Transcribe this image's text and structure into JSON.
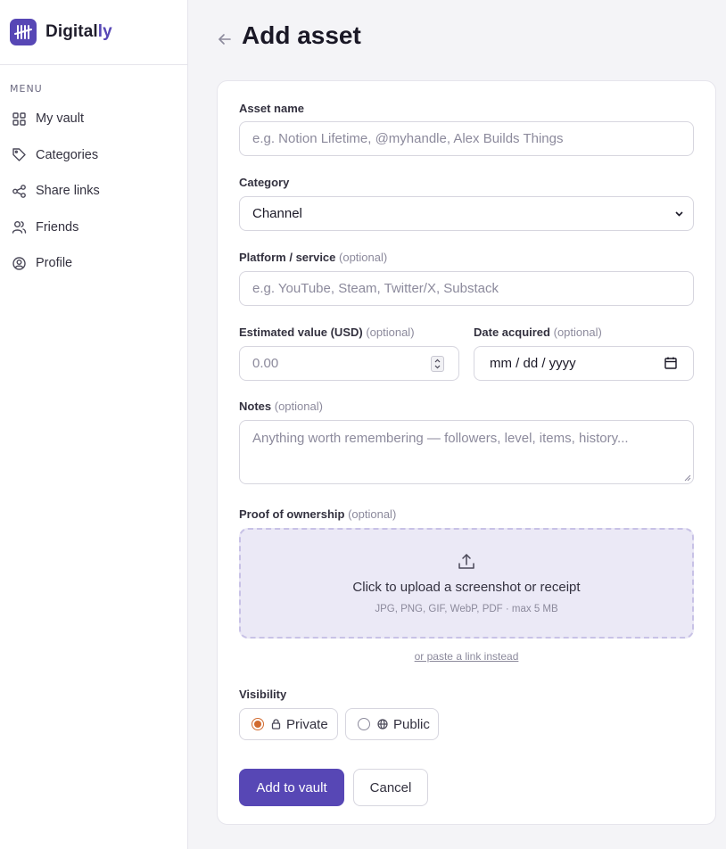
{
  "brand": {
    "name_main": "Digital",
    "name_accent": "ly",
    "accent_color": "#5747b5"
  },
  "sidebar": {
    "menu_label": "MENU",
    "items": [
      {
        "label": "My vault",
        "icon": "grid-icon"
      },
      {
        "label": "Categories",
        "icon": "tag-icon"
      },
      {
        "label": "Share links",
        "icon": "share-icon"
      },
      {
        "label": "Friends",
        "icon": "users-icon"
      },
      {
        "label": "Profile",
        "icon": "user-circle-icon"
      }
    ]
  },
  "page": {
    "title": "Add asset"
  },
  "form": {
    "asset_name": {
      "label": "Asset name",
      "placeholder": "e.g. Notion Lifetime, @myhandle, Alex Builds Things"
    },
    "category": {
      "label": "Category",
      "value": "Channel"
    },
    "platform": {
      "label": "Platform / service",
      "optional": "(optional)",
      "placeholder": "e.g. YouTube, Steam, Twitter/X, Substack"
    },
    "value": {
      "label": "Estimated value (USD)",
      "optional": "(optional)",
      "placeholder": "0.00"
    },
    "date": {
      "label": "Date acquired",
      "optional": "(optional)",
      "placeholder": "mm / dd / yyyy"
    },
    "notes": {
      "label": "Notes",
      "optional": "(optional)",
      "placeholder": "Anything worth remembering — followers, level, items, history..."
    },
    "proof": {
      "label": "Proof of ownership",
      "optional": "(optional)",
      "upload_title": "Click to upload a screenshot or receipt",
      "upload_hint": "JPG, PNG, GIF, WebP, PDF · max 5 MB",
      "paste_link": "or paste a link instead"
    },
    "visibility": {
      "label": "Visibility",
      "options": [
        {
          "label": "Private",
          "icon": "lock-icon",
          "checked": true
        },
        {
          "label": "Public",
          "icon": "globe-icon",
          "checked": false
        }
      ],
      "checked_color": "#d16a2e"
    },
    "actions": {
      "submit": "Add to vault",
      "cancel": "Cancel"
    }
  }
}
